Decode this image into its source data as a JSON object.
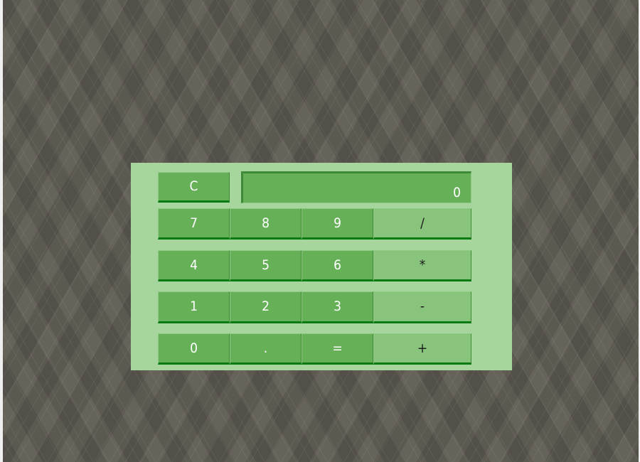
{
  "calculator": {
    "display_value": "0",
    "clear_label": "C",
    "rows": [
      [
        {
          "label": "7",
          "type": "digit"
        },
        {
          "label": "8",
          "type": "digit"
        },
        {
          "label": "9",
          "type": "digit"
        },
        {
          "label": "/",
          "type": "operator"
        }
      ],
      [
        {
          "label": "4",
          "type": "digit"
        },
        {
          "label": "5",
          "type": "digit"
        },
        {
          "label": "6",
          "type": "digit"
        },
        {
          "label": "*",
          "type": "operator"
        }
      ],
      [
        {
          "label": "1",
          "type": "digit"
        },
        {
          "label": "2",
          "type": "digit"
        },
        {
          "label": "3",
          "type": "digit"
        },
        {
          "label": "-",
          "type": "operator"
        }
      ],
      [
        {
          "label": "0",
          "type": "digit"
        },
        {
          "label": ".",
          "type": "digit"
        },
        {
          "label": "=",
          "type": "digit"
        },
        {
          "label": "+",
          "type": "operator"
        }
      ]
    ]
  },
  "colors": {
    "background": "#66635a",
    "panel": "#a6d69e",
    "button": "#66b058",
    "operator_button": "#88c47c",
    "button_underline": "#0a7a12"
  }
}
